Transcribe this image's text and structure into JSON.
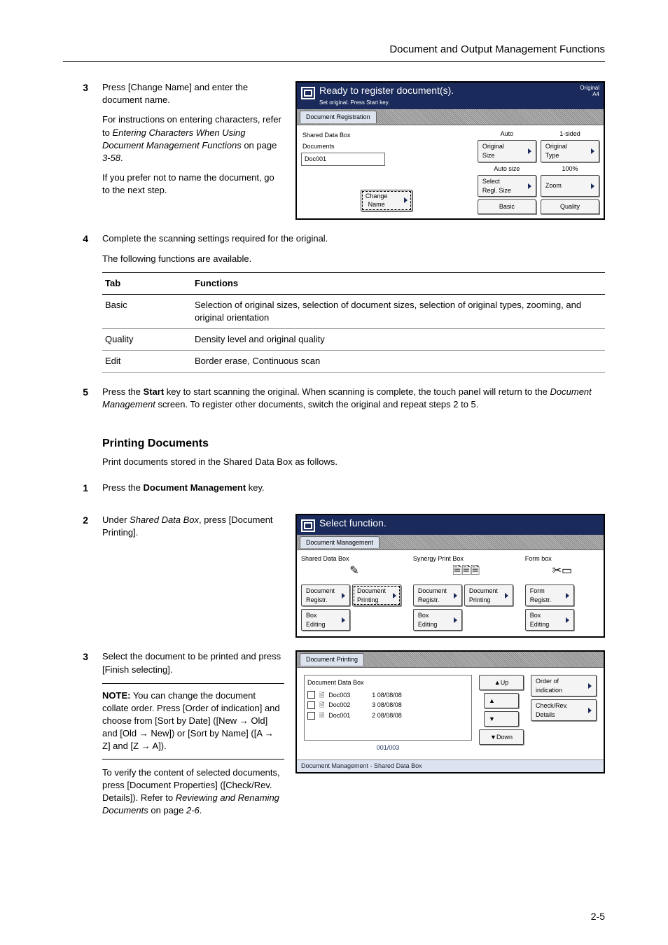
{
  "running_head": "Document and Output Management Functions",
  "step3": {
    "num": "3",
    "p1a": "Press [Change Name] and enter the document name.",
    "p2a": "For instructions on entering characters, refer to ",
    "p2b": "Entering Characters When Using Document Management Functions",
    "p2c": " on page ",
    "p2d": "3-58",
    "p2e": ".",
    "p3": "If you prefer not to name the document, go to the next step."
  },
  "step4": {
    "num": "4",
    "p1": "Complete the scanning settings required for the original.",
    "p2": "The following functions are available.",
    "th1": "Tab",
    "th2": "Functions",
    "rows": [
      {
        "tab": "Basic",
        "func": "Selection of original sizes, selection of document sizes, selection of original types, zooming, and original orientation"
      },
      {
        "tab": "Quality",
        "func": "Density level and original quality"
      },
      {
        "tab": "Edit",
        "func": "Border erase, Continuous scan"
      }
    ]
  },
  "step5": {
    "num": "5",
    "a": "Press the ",
    "b": "Start",
    "c": " key to start scanning the original. When scanning is complete, the touch panel will return to the ",
    "d": "Document Management",
    "e": " screen. To register other documents, switch the original and repeat steps 2 to 5."
  },
  "sub_heading": "Printing Documents",
  "sub_intro": "Print documents stored in the Shared Data Box as follows.",
  "pstep1": {
    "num": "1",
    "a": "Press the ",
    "b": "Document Management",
    "c": " key."
  },
  "pstep2": {
    "num": "2",
    "a": "Under ",
    "b": "Shared Data Box",
    "c": ", press [Document Printing]."
  },
  "pstep3": {
    "num": "3",
    "p1": "Select the document to be printed and press [Finish selecting].",
    "note_label": "NOTE:",
    "note_body": " You can change the document collate order. Press [Order of indication] and choose from [Sort by Date] ([New → Old] and [Old → New]) or [Sort by Name] ([A → Z] and [Z → A]).",
    "p2a": "To verify the content of selected documents, press [Document Properties] ([Check/Rev. Details]). Refer to ",
    "p2b": "Reviewing and Renaming Documents",
    "p2c": " on page ",
    "p2d": "2-6",
    "p2e": "."
  },
  "page_number": "2-5",
  "screen1": {
    "title": "Ready to register document(s).",
    "subtitle": "Set original. Press Start key.",
    "orig1": "Original",
    "orig2": "A4",
    "tab": "Document Registration",
    "box_label": "Shared Data Box",
    "docs_label": "Documents",
    "doc_name": "Doc001",
    "change_name": "Change\nName",
    "btns": {
      "auto": "Auto",
      "one_sided": "1-sided",
      "orig_size": "Original\nSize",
      "orig_type": "Original\nType",
      "auto_size": "Auto size",
      "pct": "100%",
      "sel_size": "Select\nRegl. Size",
      "zoom": "Zoom",
      "basic": "Basic",
      "quality": "Quality"
    }
  },
  "screen2": {
    "title": "Select function.",
    "tab": "Document Management",
    "col1": {
      "title": "Shared Data Box",
      "b1": "Document\nRegistr.",
      "b2": "Document\nPrinting",
      "b3": "Box\nEditing"
    },
    "col2": {
      "title": "Synergy Print Box",
      "b1": "Document\nRegistr.",
      "b2": "Document\nPrinting",
      "b3": "Box\nEditing"
    },
    "col3": {
      "title": "Form box",
      "b1": "Form\nRegistr.",
      "b3": "Box\nEditing"
    }
  },
  "screen3": {
    "tab": "Document Printing",
    "box_title": "Document Data Box",
    "rows": [
      {
        "name": "Doc003",
        "meta": "1 08/08/08"
      },
      {
        "name": "Doc002",
        "meta": "3 08/08/08"
      },
      {
        "name": "Doc001",
        "meta": "2 08/08/08"
      }
    ],
    "counter": "001/003",
    "up": "Up",
    "down": "Down",
    "order": "Order of\nindication",
    "check": "Check/Rev.\nDetails",
    "breadcrumb": "Document Management  -   Shared Data Box"
  }
}
